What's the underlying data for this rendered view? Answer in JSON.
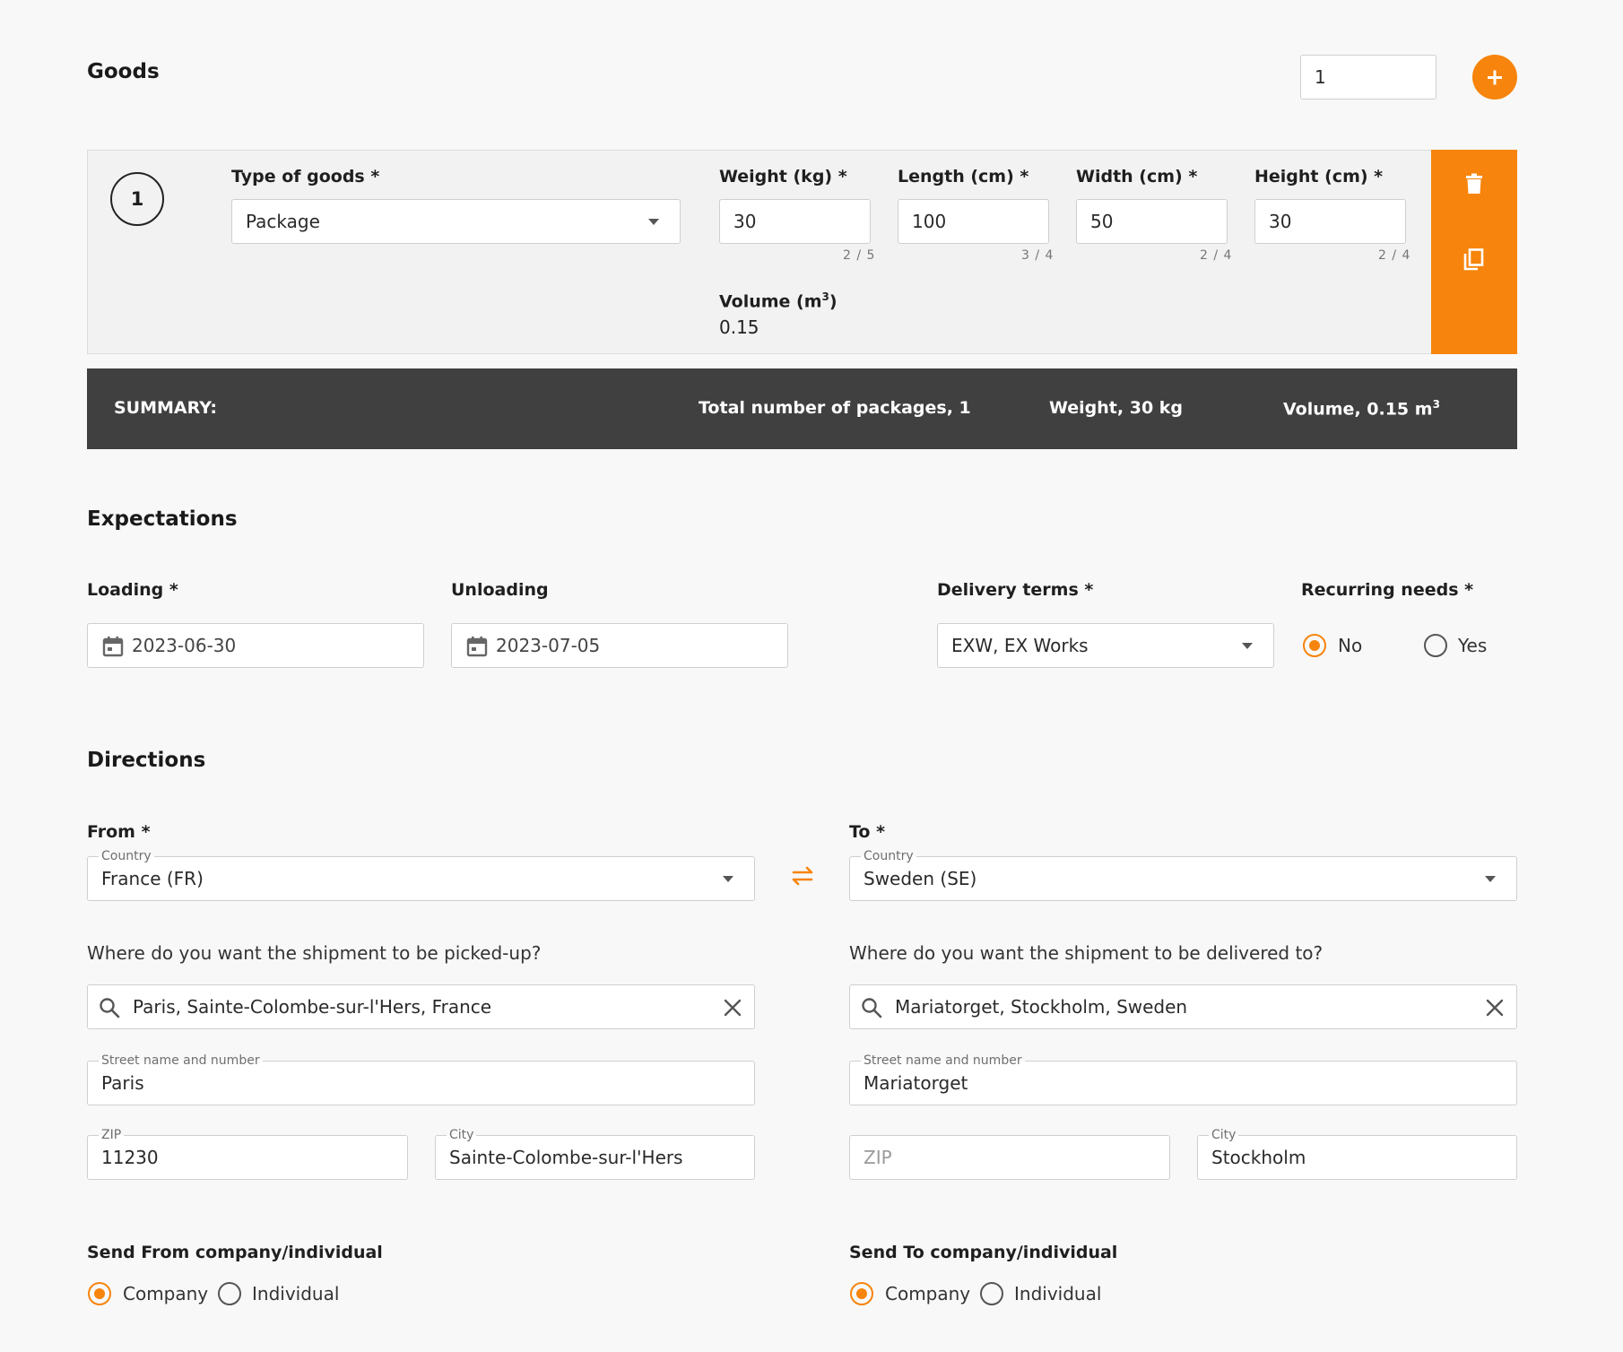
{
  "goods": {
    "title": "Goods",
    "count_value": "1",
    "add_icon": "plus-icon",
    "item": {
      "index": "1",
      "type_label": "Type of goods *",
      "type_value": "Package",
      "weight_label": "Weight (kg) *",
      "weight_value": "30",
      "weight_counter": "2 / 5",
      "length_label": "Length (cm) *",
      "length_value": "100",
      "length_counter": "3 / 4",
      "width_label": "Width (cm) *",
      "width_value": "50",
      "width_counter": "2 / 4",
      "height_label": "Height (cm) *",
      "height_value": "30",
      "height_counter": "2 / 4",
      "volume_label": "Volume (m",
      "volume_sup": "3",
      "volume_close": ")",
      "volume_value": "0.15",
      "delete_icon": "trash-icon",
      "copy_icon": "copy-icon"
    }
  },
  "summary": {
    "label": "SUMMARY:",
    "packages": "Total number of packages, 1",
    "weight": "Weight, 30 kg",
    "volume": "Volume, 0.15 m",
    "volume_sup": "3"
  },
  "expectations": {
    "title": "Expectations",
    "loading_label": "Loading *",
    "loading_value": "2023-06-30",
    "unloading_label": "Unloading",
    "unloading_value": "2023-07-05",
    "delivery_label": "Delivery terms *",
    "delivery_value": "EXW, EX Works",
    "recurring_label": "Recurring needs *",
    "recurring_options": [
      "No",
      "Yes"
    ],
    "recurring_selected": "No"
  },
  "directions": {
    "title": "Directions",
    "from": {
      "label": "From *",
      "country_label": "Country",
      "country_value": "France (FR)",
      "question": "Where do you want the shipment to be picked-up?",
      "search_value": "Paris, Sainte-Colombe-sur-l'Hers, France",
      "street_label": "Street name and number",
      "street_value": "Paris",
      "zip_label": "ZIP",
      "zip_value": "11230",
      "city_label": "City",
      "city_value": "Sainte-Colombe-sur-l'Hers",
      "send_label": "Send From company/individual",
      "options": [
        "Company",
        "Individual"
      ],
      "selected": "Company"
    },
    "to": {
      "label": "To *",
      "country_label": "Country",
      "country_value": "Sweden (SE)",
      "question": "Where do you want the shipment to be delivered to?",
      "search_value": "Mariatorget, Stockholm, Sweden",
      "street_label": "Street name and number",
      "street_value": "Mariatorget",
      "zip_placeholder": "ZIP",
      "zip_value": "",
      "city_label": "City",
      "city_value": "Stockholm",
      "send_label": "Send To company/individual",
      "options": [
        "Company",
        "Individual"
      ],
      "selected": "Company"
    },
    "swap_icon": "swap-arrows-icon"
  },
  "colors": {
    "accent": "#f7840c",
    "summary_bg": "#404040",
    "card_bg": "#f2f2f2"
  }
}
